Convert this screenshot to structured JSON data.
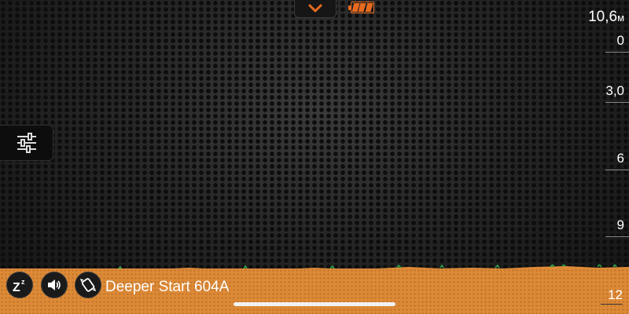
{
  "device": {
    "name": "Deeper Start 604A"
  },
  "depth_scale": {
    "max_value": "10,6",
    "max_unit": "м",
    "ticks": [
      "0",
      "3,0",
      "6",
      "9",
      "12"
    ]
  },
  "battery": {
    "level_fraction": 1.0,
    "color": "#e86a1e"
  },
  "colors": {
    "accent": "#e86a1e",
    "bottom": "#dd8a37",
    "grass": "#2fa34a"
  },
  "icons": {
    "top_toggle": "chevron-down-icon",
    "settings": "sliders-icon",
    "sleep": "sleep-zz-icon",
    "sound": "speaker-icon",
    "device": "device-tilt-icon"
  }
}
